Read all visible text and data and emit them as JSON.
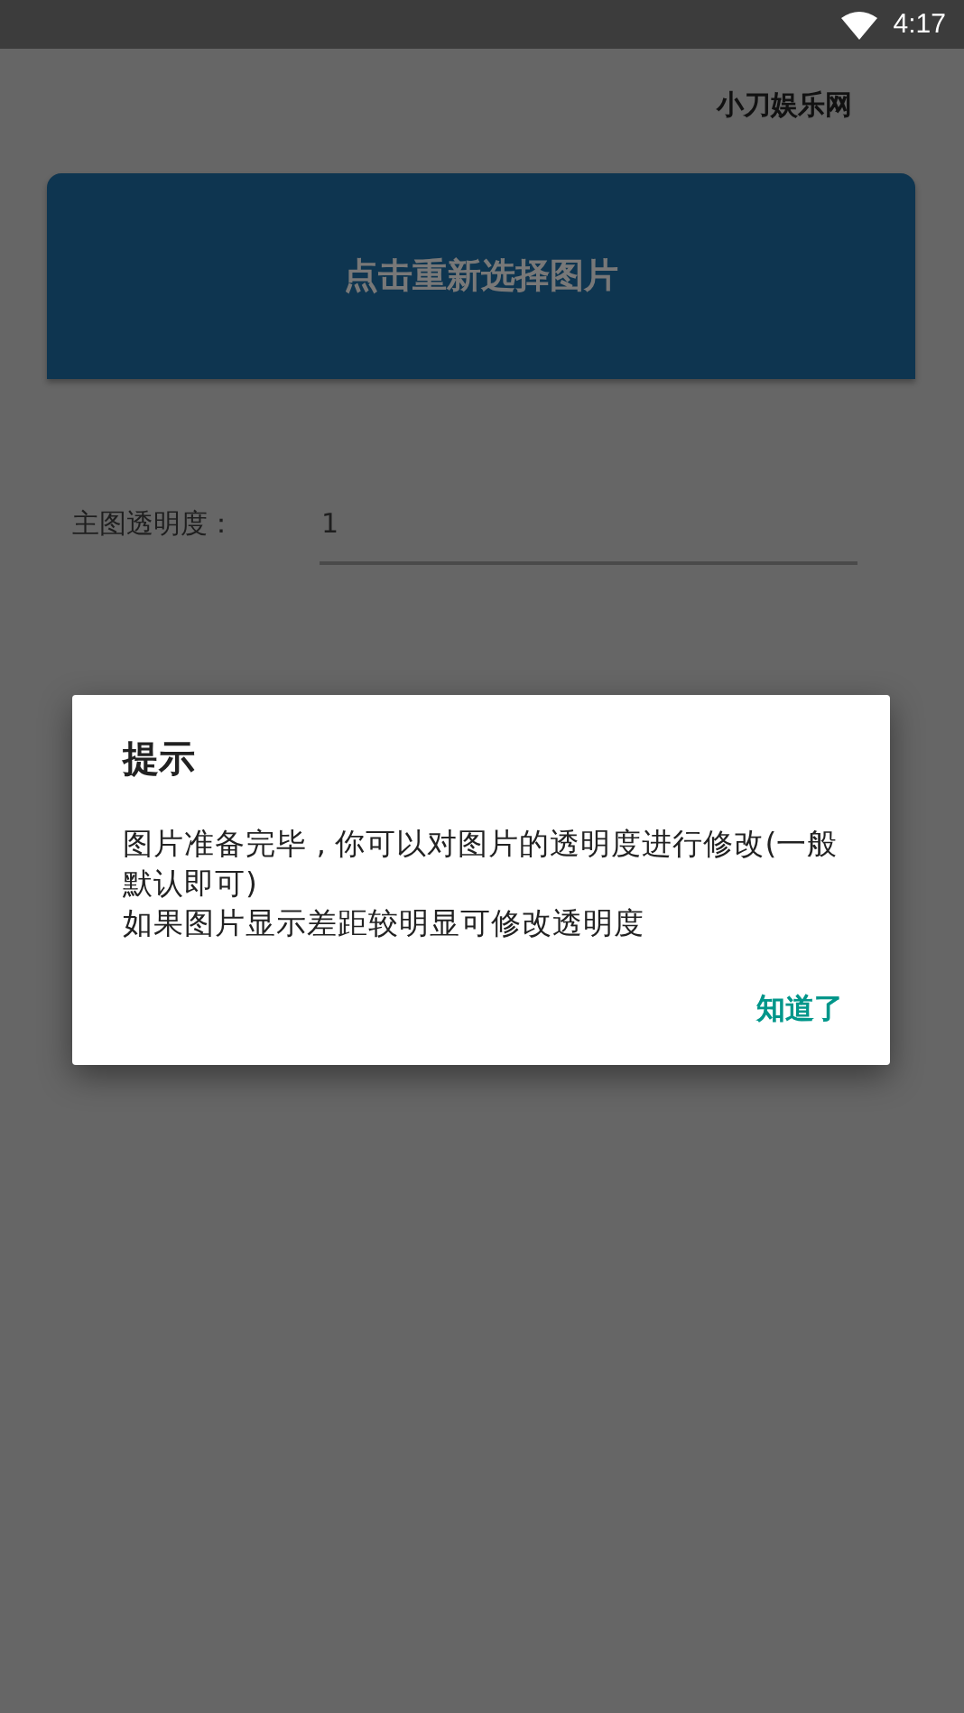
{
  "status_bar": {
    "time": "4:17"
  },
  "header": {
    "title": "小刀娱乐网"
  },
  "pick_button": {
    "label": "点击重新选择图片"
  },
  "fields": [
    {
      "label": "主图透明度：",
      "value": "1"
    }
  ],
  "dialog": {
    "title": "提示",
    "message_lines": [
      "图片准备完毕 , 你可以对图片的透明度进行修改(一般默认即可)",
      "如果图片显示差距较明显可修改透明度"
    ],
    "button": "知道了"
  }
}
